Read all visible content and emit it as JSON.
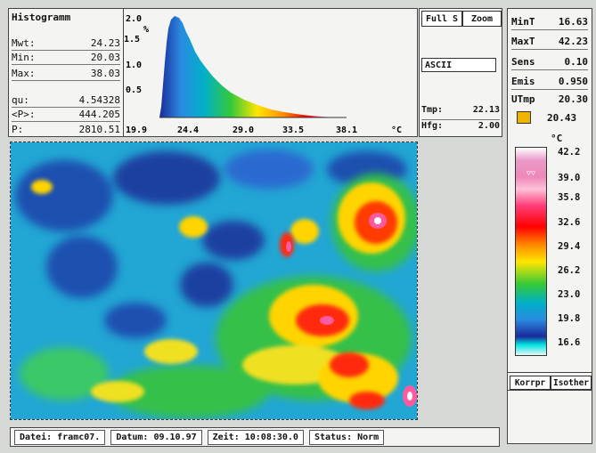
{
  "histogram": {
    "title": "Histogramm",
    "stats": [
      {
        "label": "Mwt:",
        "value": "24.23"
      },
      {
        "label": "Min:",
        "value": "20.03"
      },
      {
        "label": "Max:",
        "value": "38.03"
      },
      {
        "label": "qu:",
        "value": "4.54328"
      },
      {
        "label": "<P>:",
        "value": "444.205"
      },
      {
        "label": "P:",
        "value": "2810.51"
      }
    ],
    "y_unit": "%",
    "y_ticks": [
      "2.0",
      "1.5",
      "1.0",
      "0.5"
    ],
    "x_ticks": [
      "19.9",
      "24.4",
      "29.0",
      "33.5",
      "38.1"
    ],
    "x_unit": "°C"
  },
  "buttons": {
    "full_s": "Full S",
    "zoom": "Zoom",
    "ascii": "ASCII"
  },
  "readouts": {
    "tmp_label": "Tmp:",
    "tmp_value": "22.13",
    "hfg_label": "Hfg:",
    "hfg_value": "2.00"
  },
  "right_panel": {
    "params": [
      {
        "label": "MinT",
        "value": "16.63"
      },
      {
        "label": "MaxT",
        "value": "42.23"
      },
      {
        "label": "Sens",
        "value": "0.10"
      },
      {
        "label": "Emis",
        "value": "0.950"
      },
      {
        "label": "UTmp",
        "value": "20.30"
      }
    ],
    "cursor_value": "20.43",
    "unit": "°C",
    "scale_labels": [
      "42.2",
      "39.0",
      "35.8",
      "32.6",
      "29.4",
      "26.2",
      "23.0",
      "19.8",
      "16.6"
    ],
    "korr_button": "Korrpr",
    "isother_button": "Isother"
  },
  "status_bar": {
    "datei": "Datei: framc07.",
    "datum": "Datum: 09.10.97",
    "zeit": "Zeit: 10:08:30.0",
    "status": "Status: Norm"
  },
  "colors": {
    "scale": [
      "#ffffff",
      "#e99ac8",
      "#ff3c78",
      "#ff0000",
      "#ff8a00",
      "#ffe600",
      "#33c83a",
      "#00b0c8",
      "#2a8ae0",
      "#1a2a9a",
      "#00e4e0"
    ]
  }
}
